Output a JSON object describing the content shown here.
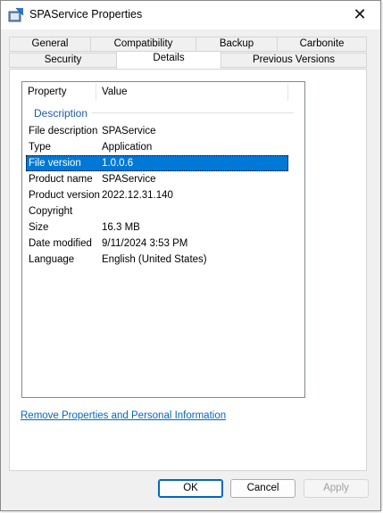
{
  "window": {
    "title": "SPAService Properties"
  },
  "tabs": {
    "row1": [
      "General",
      "Compatibility",
      "Backup",
      "Carbonite"
    ],
    "row2": [
      "Security",
      "Details",
      "Previous Versions"
    ],
    "active": "Details"
  },
  "details": {
    "header": {
      "property": "Property",
      "value": "Value"
    },
    "group": "Description",
    "rows": [
      {
        "property": "File description",
        "value": "SPAService"
      },
      {
        "property": "Type",
        "value": "Application"
      },
      {
        "property": "File version",
        "value": "1.0.0.6",
        "selected": true
      },
      {
        "property": "Product name",
        "value": "SPAService"
      },
      {
        "property": "Product version",
        "value": "2022.12.31.140"
      },
      {
        "property": "Copyright",
        "value": ""
      },
      {
        "property": "Size",
        "value": "16.3 MB"
      },
      {
        "property": "Date modified",
        "value": "9/11/2024 3:53 PM"
      },
      {
        "property": "Language",
        "value": "English (United States)"
      }
    ]
  },
  "link": "Remove Properties and Personal Information",
  "buttons": {
    "ok": "OK",
    "cancel": "Cancel",
    "apply": "Apply"
  },
  "colors": {
    "selection": "#0078d7",
    "link": "#0066cc",
    "group": "#1e5bb0"
  }
}
